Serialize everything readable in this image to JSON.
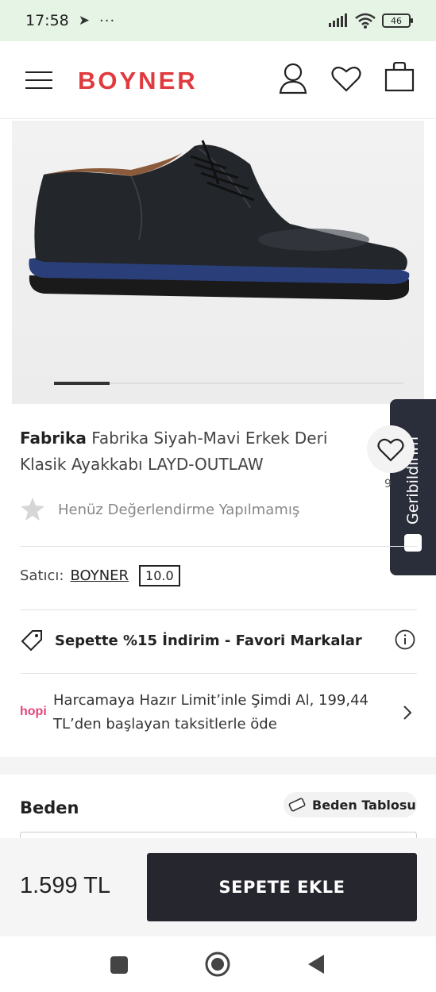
{
  "status_bar": {
    "time": "17:58",
    "battery": "46"
  },
  "header": {
    "logo": "BOYNER"
  },
  "gallery": {
    "slide_index": 1
  },
  "product": {
    "brand": "Fabrika",
    "title": "Fabrika Siyah-Mavi Erkek Deri Klasik Ayakkabı LAYD-OUTLAW",
    "favorite_count": "9",
    "rating_text": "Henüz Değerlendirme Yapılmamış"
  },
  "seller": {
    "label": "Satıcı:",
    "name": "BOYNER",
    "score": "10.0"
  },
  "promo": {
    "text": "Sepette %15 İndirim - Favori Markalar"
  },
  "hopi": {
    "logo": "hopi",
    "text": "Harcamaya Hazır Limit’inle Şimdi Al, 199,44 TL’den başlayan taksitlerle öde"
  },
  "size": {
    "label": "Beden",
    "table_button": "Beden Tablosu"
  },
  "bottom_bar": {
    "price": "1.599 TL",
    "add_to_cart": "SEPETE EKLE"
  },
  "feedback_tab": {
    "label": "Geribildirim"
  },
  "colors": {
    "brand_red": "#e03a3e",
    "cta_dark": "#26262f",
    "feedback_dark": "#2a2d3a"
  }
}
